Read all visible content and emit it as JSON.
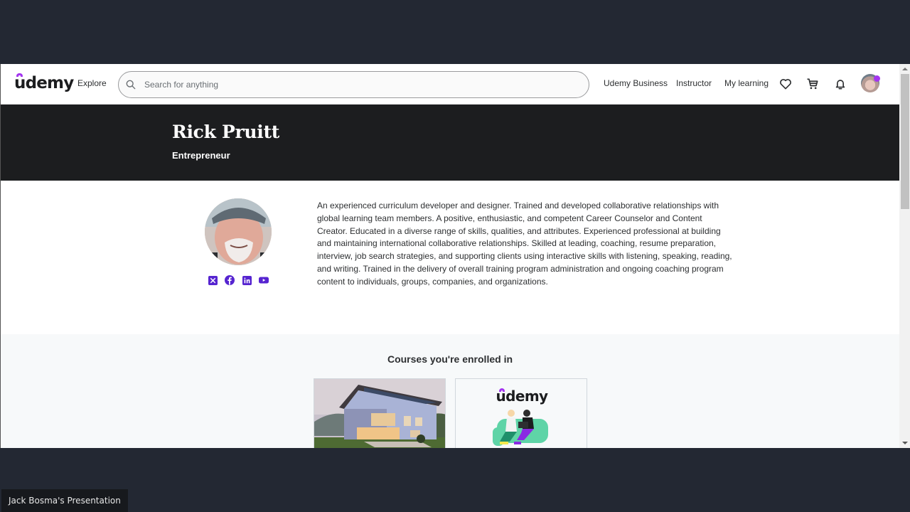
{
  "header": {
    "logo": "ūdemy",
    "explore": "Explore",
    "search_placeholder": "Search for anything",
    "search_value": "",
    "nav": {
      "business": "Udemy Business",
      "instructor": "Instructor",
      "my_learning": "My learning"
    },
    "icons": [
      "heart-icon",
      "cart-icon",
      "bell-icon"
    ],
    "notification_dot": true
  },
  "profile": {
    "name": "Rick Pruitt",
    "headline": "Entrepreneur",
    "socials": [
      "x-icon",
      "facebook-icon",
      "linkedin-icon",
      "youtube-icon"
    ],
    "bio": "An experienced curriculum developer and designer. Trained and developed collaborative relationships with global learning team members. A positive, enthusiastic, and competent Career Counselor and Content Creator. Educated in a diverse range of skills, qualities, and attributes. Experienced professional at building and maintaining international collaborative relationships. Skilled at leading, coaching, resume preparation, interview, job search strategies, and supporting clients using interactive skills with listening, speaking, reading, and writing. Trained in the delivery of overall training program administration and ongoing coaching program content to individuals, groups, companies, and organizations."
  },
  "courses": {
    "title": "Courses you're enrolled in",
    "cards": [
      {
        "thumbnail": "modern house with solar panels"
      },
      {
        "thumbnail": "udemy logo illustration",
        "logo": "ūdemy"
      }
    ]
  },
  "colors": {
    "brand": "#a435f0",
    "banner": "#1c1d1f"
  },
  "presenter": {
    "label": "Jack Bosma's Presentation"
  }
}
